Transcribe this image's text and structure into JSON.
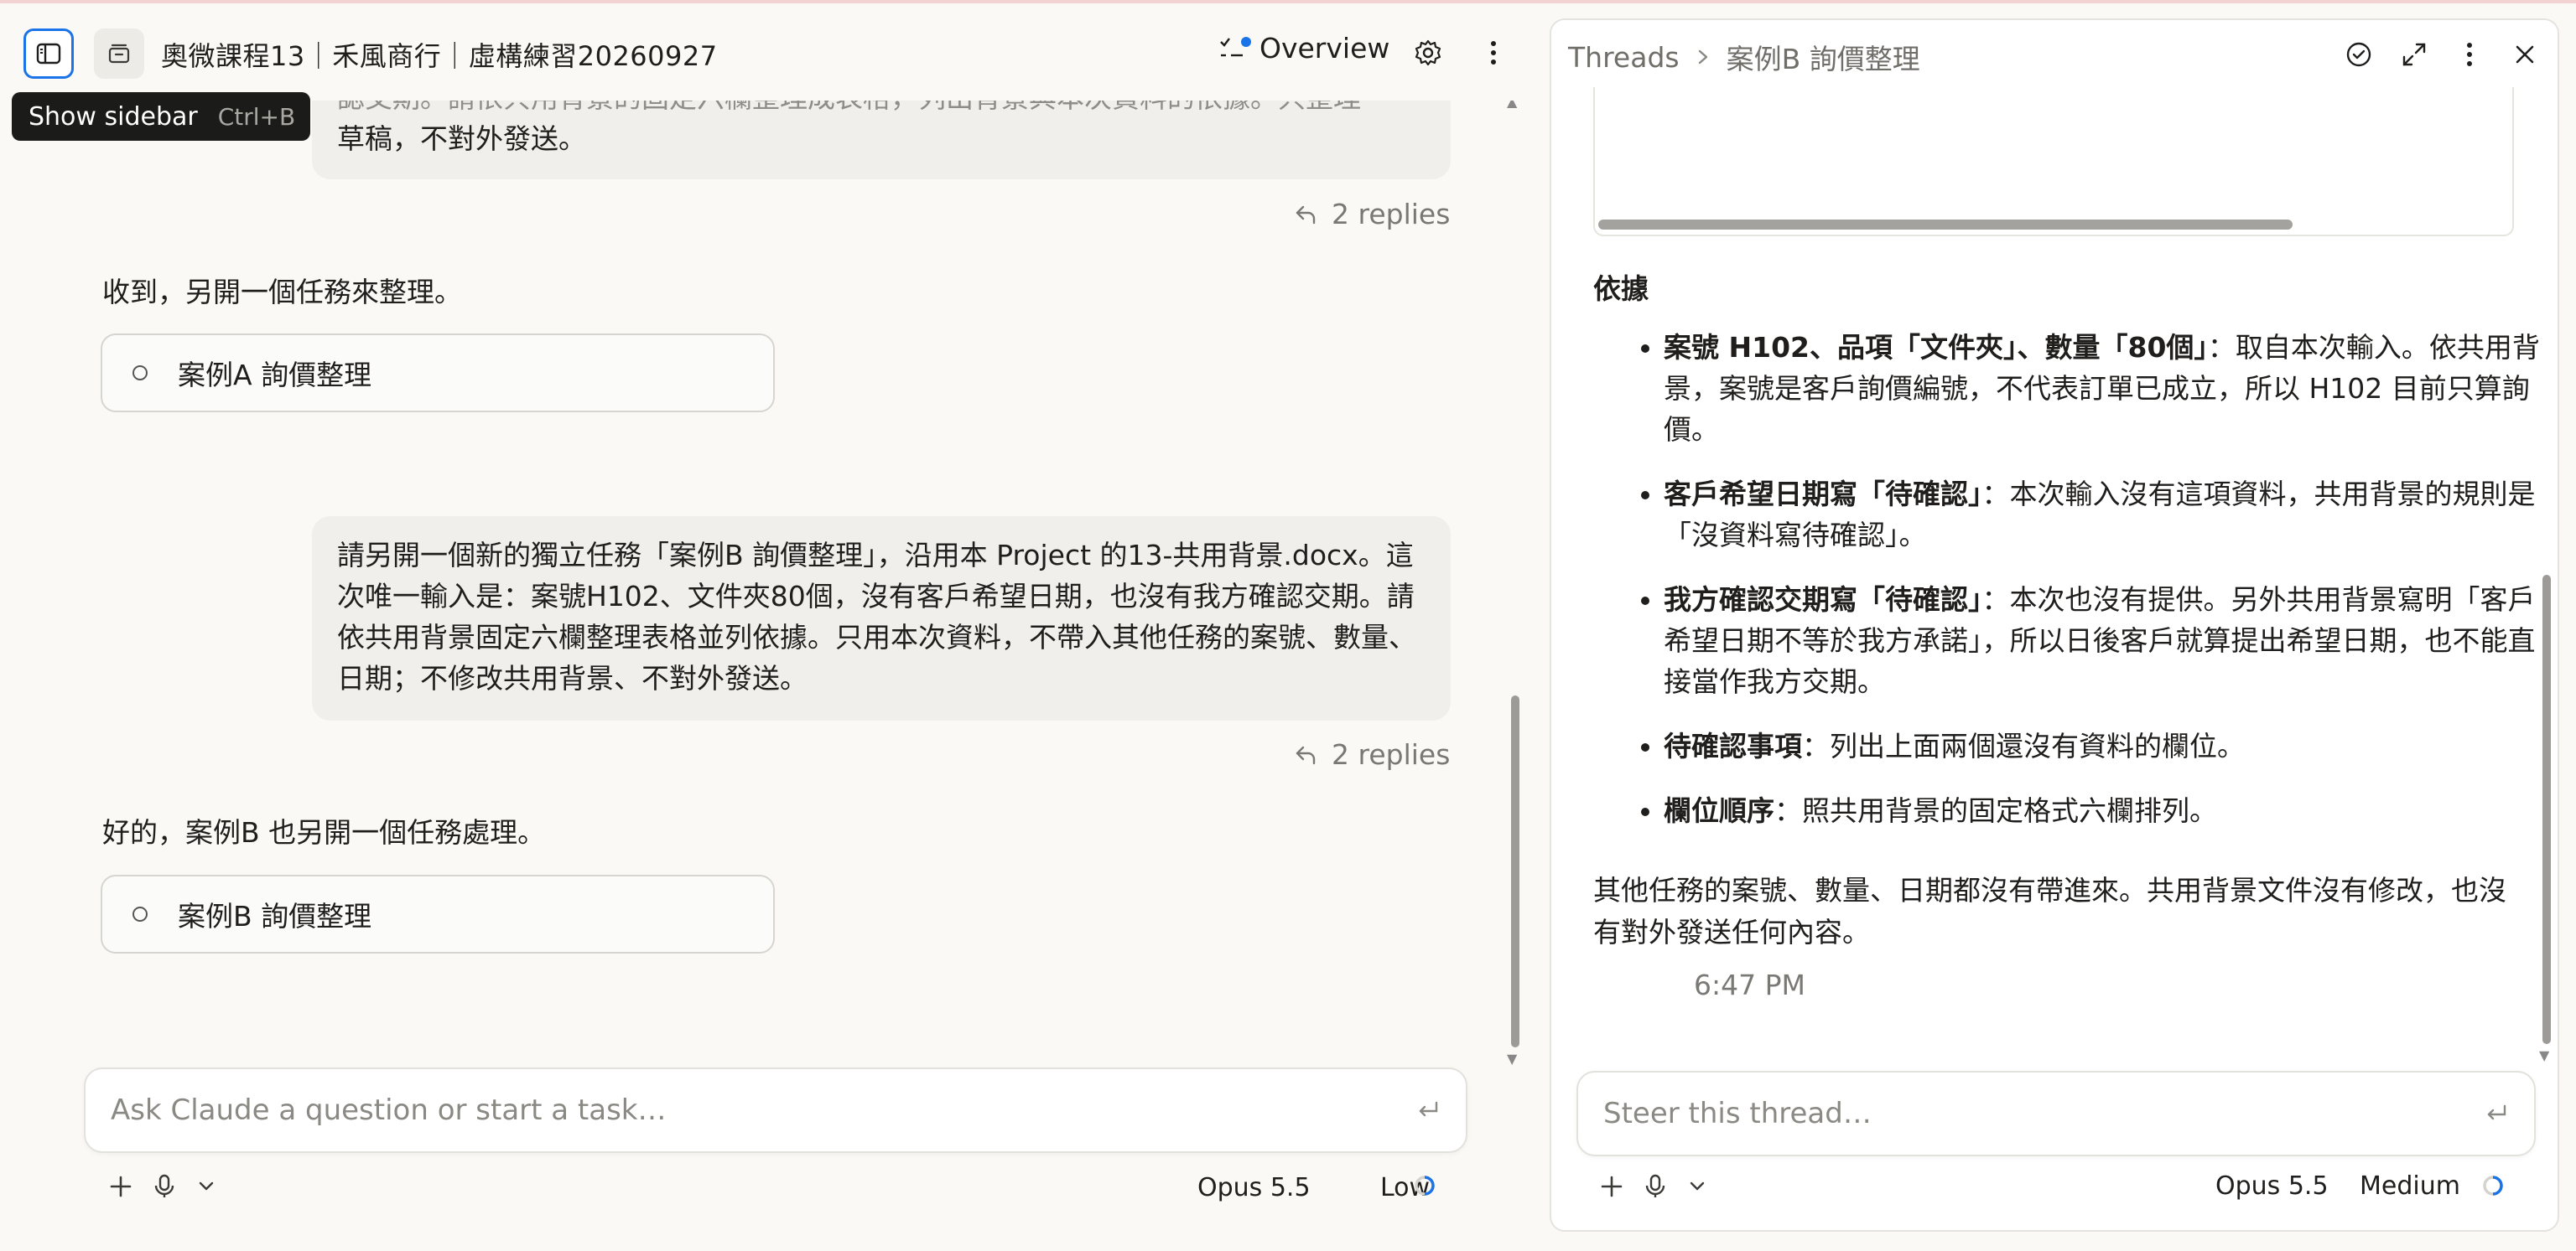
{
  "header": {
    "project_title": "奧微課程13｜禾風商行｜虛構練習20260927",
    "overview_label": "Overview"
  },
  "tooltip": {
    "label": "Show sidebar",
    "shortcut": "Ctrl+B"
  },
  "conversation": {
    "user_message_1": {
      "line1": "認交期。請依共用背景的固定六欄整理成表格，列出背景與本次資料的依據。只整理",
      "line2": "草稿，不對外發送。"
    },
    "replies_1": "2 replies",
    "assistant_1": "收到，另開一個任務來整理。",
    "task_chip_1": "案例A 詢價整理",
    "user_message_2": "請另開一個新的獨立任務「案例B 詢價整理」，沿用本 Project 的13-共用背景.docx。這次唯一輸入是：案號H102、文件夾80個，沒有客戶希望日期，也沒有我方確認交期。請依共用背景固定六欄整理表格並列依據。只用本次資料，不帶入其他任務的案號、數量、日期；不修改共用背景、不對外發送。",
    "replies_2": "2 replies",
    "assistant_2": "好的，案例B 也另開一個任務處理。",
    "task_chip_2": "案例B 詢價整理"
  },
  "composer": {
    "placeholder": "Ask Claude a question or start a task…",
    "model": "Opus 5.5",
    "effort": "Low"
  },
  "thread_panel": {
    "breadcrumb_root": "Threads",
    "breadcrumb_current": "案例B 詢價整理",
    "heading": "依據",
    "basis": [
      {
        "title": "案號 H102、品項「文件夾」、數量「80個」",
        "text": "：取自本次輸入。依共用背景，案號是客戶詢價編號，不代表訂單已成立，所以 H102 目前只算詢價。"
      },
      {
        "title": "客戶希望日期寫「待確認」",
        "text": "：本次輸入沒有這項資料，共用背景的規則是「沒資料寫待確認」。"
      },
      {
        "title": "我方確認交期寫「待確認」",
        "text": "：本次也沒有提供。另外共用背景寫明「客戶希望日期不等於我方承諾」，所以日後客戶就算提出希望日期，也不能直接當作我方交期。"
      },
      {
        "title": "待確認事項",
        "text": "：列出上面兩個還沒有資料的欄位。"
      },
      {
        "title": "欄位順序",
        "text": "：照共用背景的固定格式六欄排列。"
      }
    ],
    "closing": "其他任務的案號、數量、日期都沒有帶進來。共用背景文件沒有修改，也沒有對外發送任何內容。",
    "timestamp": "6:47 PM",
    "composer": {
      "placeholder": "Steer this thread…",
      "model": "Opus 5.5",
      "effort": "Medium"
    }
  },
  "colors": {
    "accent": "#1a73e8",
    "background": "#faf9f5",
    "bubble": "#f0efeb"
  }
}
